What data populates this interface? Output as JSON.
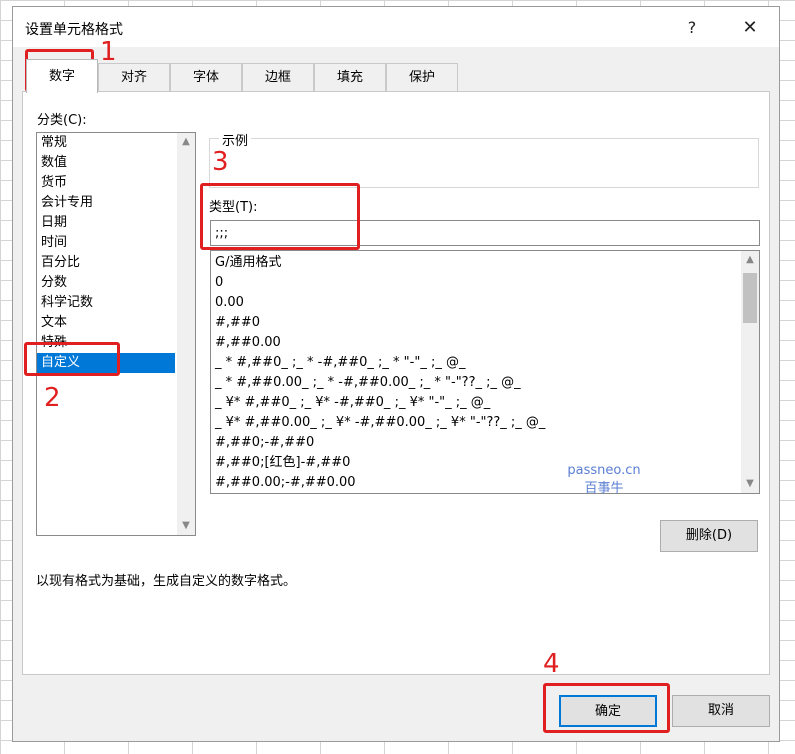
{
  "dialog": {
    "title": "设置单元格格式",
    "help": "?",
    "close": "✕"
  },
  "tabs": [
    "数字",
    "对齐",
    "字体",
    "边框",
    "填充",
    "保护"
  ],
  "category": {
    "label": "分类(C):",
    "items": [
      "常规",
      "数值",
      "货币",
      "会计专用",
      "日期",
      "时间",
      "百分比",
      "分数",
      "科学记数",
      "文本",
      "特殊",
      "自定义"
    ],
    "selected_index": 11
  },
  "sample": {
    "label": "示例"
  },
  "type": {
    "label": "类型(T):",
    "value": ";;;"
  },
  "formats": [
    "G/通用格式",
    "0",
    "0.00",
    "#,##0",
    "#,##0.00",
    "_ * #,##0_ ;_ * -#,##0_ ;_ * \"-\"_ ;_ @_",
    "_ * #,##0.00_ ;_ * -#,##0.00_ ;_ * \"-\"??_ ;_ @_",
    "_ ¥* #,##0_ ;_ ¥* -#,##0_ ;_ ¥* \"-\"_ ;_ @_",
    "_ ¥* #,##0.00_ ;_ ¥* -#,##0.00_ ;_ ¥* \"-\"??_ ;_ @_",
    "#,##0;-#,##0",
    "#,##0;[红色]-#,##0",
    "#,##0.00;-#,##0.00"
  ],
  "delete_button": "删除(D)",
  "description": "以现有格式为基础，生成自定义的数字格式。",
  "ok_button": "确定",
  "cancel_button": "取消",
  "watermark": {
    "line1": "passneo.cn",
    "line2": "百事牛"
  },
  "annotations": [
    "1",
    "2",
    "3",
    "4"
  ],
  "colors": {
    "accent": "#0078d7",
    "annotation": "#e02020"
  }
}
